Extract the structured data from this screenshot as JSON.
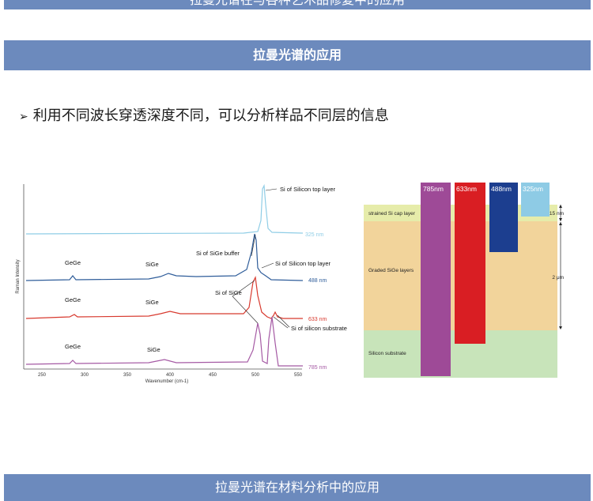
{
  "header": {
    "partial_title": "拉曼光谱在与各种艺术品修复中的应用"
  },
  "section_title": "拉曼光谱的应用",
  "bullet": {
    "marker": "➢",
    "text": "利用不同波长穿透深度不同，可以分析样品不同层的信息"
  },
  "spectrum": {
    "y_axis_label": "Raman Intensity",
    "x_axis_label": "Wavenumber (cm-1)",
    "x_ticks": [
      "250",
      "300",
      "350",
      "400",
      "450",
      "500",
      "550"
    ],
    "annotations": {
      "si_top_1": "Si of Silicon top layer",
      "gege_1": "GeGe",
      "sige_1": "SiGe",
      "si_sige_buffer": "Si of SiGe buffer",
      "si_top_2": "Si of Silicon top layer",
      "gege_2": "GeGe",
      "sige_2": "SiGe",
      "si_of_sige": "Si of SiGe",
      "si_substrate": "Si of silicon substrate",
      "gege_3": "GeGe",
      "sige_3": "SiGe"
    },
    "series": [
      {
        "name": "325 nm",
        "color": "#8fcde6"
      },
      {
        "name": "488 nm",
        "color": "#2f5d9a"
      },
      {
        "name": "633 nm",
        "color": "#d83a2f"
      },
      {
        "name": "785 nm",
        "color": "#a55aa4"
      }
    ]
  },
  "layers": {
    "layer_labels": {
      "cap": "strained Si cap layer",
      "graded": "Graded SiGe layers",
      "substrate": "Silicon substrate"
    },
    "dims": {
      "cap": "15 nm",
      "graded": "2 μm"
    },
    "colors": {
      "cap": "#e6ecaa",
      "graded": "#f2d49b",
      "substrate": "#c8e4ba"
    },
    "wavelengths": [
      {
        "label": "785nm",
        "color": "#9e4a97"
      },
      {
        "label": "633nm",
        "color": "#d91e23"
      },
      {
        "label": "488nm",
        "color": "#1c3e8f"
      },
      {
        "label": "325nm",
        "color": "#8ecbe5"
      }
    ]
  },
  "footer_title": "拉曼光谱在材料分析中的应用"
}
